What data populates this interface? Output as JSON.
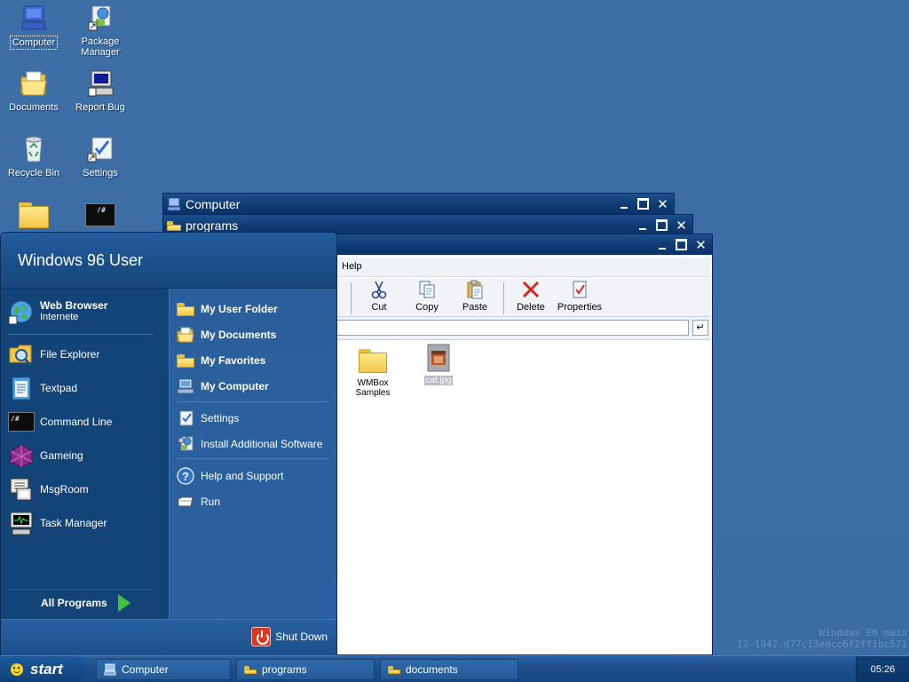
{
  "desktop": {
    "icons": [
      {
        "label": "Computer",
        "icon": "computer-icon"
      },
      {
        "label": "Package Manager",
        "icon": "package-manager-icon"
      },
      {
        "label": "Documents",
        "icon": "documents-folder-icon"
      },
      {
        "label": "Report Bug",
        "icon": "report-bug-icon"
      },
      {
        "label": "Recycle Bin",
        "icon": "recycle-bin-icon"
      },
      {
        "label": "Settings",
        "icon": "settings-icon"
      },
      {
        "label": "",
        "icon": "folder-icon"
      },
      {
        "label": "",
        "icon": "terminal-icon"
      }
    ]
  },
  "windows": {
    "computer": {
      "title": "Computer"
    },
    "programs": {
      "title": "programs"
    },
    "documents": {
      "title": "",
      "menu": {
        "help": "Help"
      },
      "toolbar": {
        "cut": "Cut",
        "copy": "Copy",
        "paste": "Paste",
        "delete": "Delete",
        "properties": "Properties"
      },
      "address": {
        "value": "",
        "go": "↵"
      },
      "files": [
        {
          "name": "WMBox Samples",
          "icon": "folder-icon",
          "selected": false
        },
        {
          "name": "cat.jpg",
          "icon": "image-file-icon",
          "selected": true
        }
      ]
    }
  },
  "start_menu": {
    "user_name": "Windows 96 User",
    "pinned": {
      "title": "Web Browser",
      "subtitle": "Internete"
    },
    "left_items": [
      {
        "label": "File Explorer",
        "icon": "file-explorer-icon"
      },
      {
        "label": "Textpad",
        "icon": "textpad-icon"
      },
      {
        "label": "Command Line",
        "icon": "command-line-icon"
      },
      {
        "label": "Gameing",
        "icon": "gaming-icon"
      },
      {
        "label": "MsgRoom",
        "icon": "msgroom-icon"
      },
      {
        "label": "Task Manager",
        "icon": "task-manager-icon"
      }
    ],
    "all_programs": "All Programs",
    "right_items": [
      {
        "label": "My User Folder",
        "icon": "folder-icon",
        "bold": true
      },
      {
        "label": "My Documents",
        "icon": "documents-folder-icon",
        "bold": true
      },
      {
        "label": "My Favorites",
        "icon": "folder-icon",
        "bold": true
      },
      {
        "label": "My Computer",
        "icon": "computer-icon",
        "bold": true
      },
      {
        "label": "Settings",
        "icon": "settings-icon",
        "bold": false
      },
      {
        "label": "Install Additional Software",
        "icon": "install-software-icon",
        "bold": false
      },
      {
        "label": "Help and Support",
        "icon": "help-icon",
        "bold": false
      },
      {
        "label": "Run",
        "icon": "run-icon",
        "bold": false
      }
    ],
    "shutdown": "Shut Down"
  },
  "taskbar": {
    "start_label": "start",
    "tasks": [
      {
        "label": "Computer",
        "icon": "computer-icon"
      },
      {
        "label": "programs",
        "icon": "folder-icon"
      },
      {
        "label": "documents",
        "icon": "folder-icon"
      }
    ],
    "clock": "05:26"
  },
  "watermark": {
    "line1": "Windows 96 main",
    "line2": "12-1942.d77c13edcc6f2ff1bc571"
  }
}
